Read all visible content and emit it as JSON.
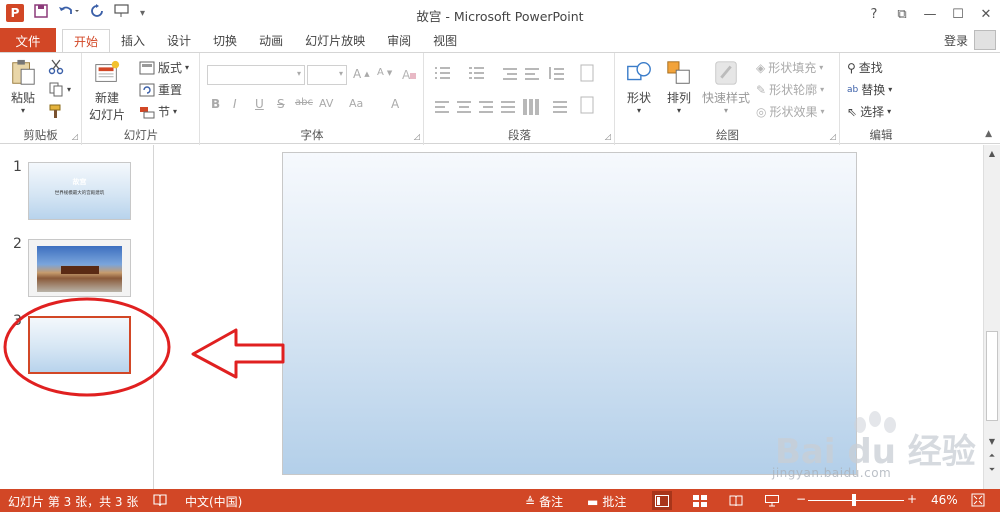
{
  "window": {
    "title": "故宫 - Microsoft PowerPoint",
    "controls": [
      "?",
      "⧉",
      "—",
      "☐",
      "✕"
    ]
  },
  "qat": {
    "logo": "P"
  },
  "tabs": {
    "file": "文件",
    "items": [
      "开始",
      "插入",
      "设计",
      "切换",
      "动画",
      "幻灯片放映",
      "审阅",
      "视图"
    ],
    "active": "开始",
    "login": "登录"
  },
  "ribbon": {
    "clipboard": {
      "label": "剪贴板",
      "paste": "粘贴"
    },
    "slides": {
      "label": "幻灯片",
      "new_slide_1": "新建",
      "new_slide_2": "幻灯片",
      "layout": "版式",
      "reset": "重置",
      "section": "节"
    },
    "font": {
      "label": "字体",
      "buttons": [
        "B",
        "I",
        "U",
        "S",
        "abc",
        "AV",
        "Aa",
        "A"
      ]
    },
    "paragraph": {
      "label": "段落"
    },
    "drawing": {
      "label": "绘图",
      "shapes": "形状",
      "arrange": "排列",
      "quick_styles": "快速样式",
      "fill": "形状填充",
      "outline": "形状轮廓",
      "effects": "形状效果"
    },
    "editing": {
      "label": "编辑",
      "find": "查找",
      "replace": "替换",
      "select": "选择"
    }
  },
  "thumbnails": [
    {
      "num": "1",
      "title": "故宫",
      "subtitle": "世界规模最大的宫殿建筑"
    },
    {
      "num": "2"
    },
    {
      "num": "3"
    }
  ],
  "status": {
    "slide_info": "幻灯片 第 3 张，共 3 张",
    "language": "中文(中国)",
    "notes": "备注",
    "comments": "批注",
    "zoom": "46%"
  },
  "watermark": {
    "brand": "Bai du 经验",
    "url": "jingyan.baidu.com"
  },
  "colors": {
    "accent": "#d24726",
    "annotation": "#e02020"
  }
}
